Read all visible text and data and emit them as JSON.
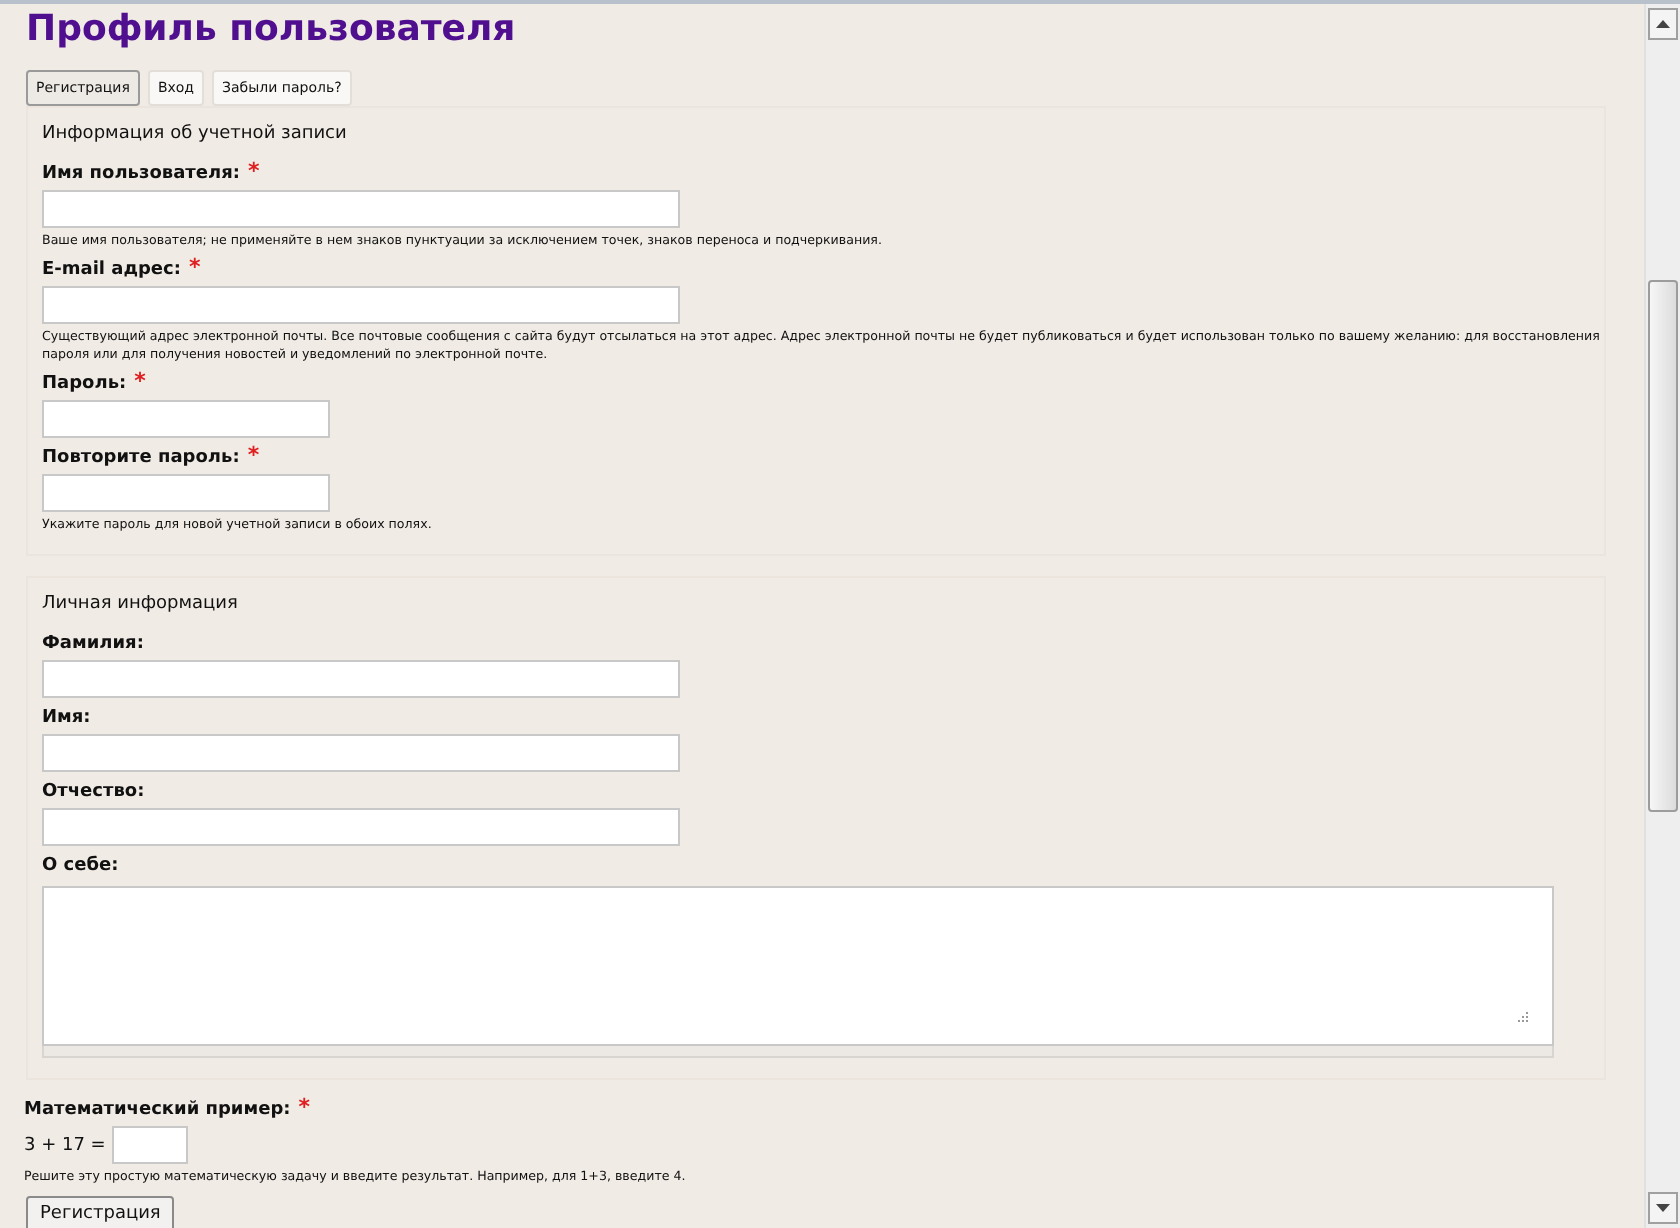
{
  "title": "Профиль пользователя",
  "tabs": [
    {
      "label": "Регистрация",
      "selected": true
    },
    {
      "label": "Вход",
      "selected": false
    },
    {
      "label": "Забыли пароль?",
      "selected": false
    }
  ],
  "required_mark": "*",
  "sections": [
    {
      "legend": "Информация об учетной записи",
      "fields": [
        {
          "kind": "wide_input",
          "label": "Имя пользователя:",
          "required": true,
          "description": "Ваше имя пользователя; не применяйте в нем знаков пунктуации за исключением точек, знаков переноса и подчеркивания."
        },
        {
          "kind": "wide_input",
          "label": "E-mail адрес:",
          "required": true,
          "description": "Существующий адрес электронной почты. Все почтовые сообщения с сайта будут отсылаться на этот адрес. Адрес электронной почты не будет публиковаться и будет использован только по вашему желанию: для восстановления пароля или для получения новостей и уведомлений по электронной почте."
        },
        {
          "kind": "narrow_input",
          "label": "Пароль:",
          "required": true
        },
        {
          "kind": "narrow_input",
          "label": "Повторите пароль:",
          "required": true,
          "description": "Укажите пароль для новой учетной записи в обоих полях."
        }
      ]
    },
    {
      "legend": "Личная информация",
      "fields": [
        {
          "kind": "wide_input",
          "label": "Фамилия:"
        },
        {
          "kind": "wide_input",
          "label": "Имя:"
        },
        {
          "kind": "wide_input",
          "label": "Отчество:"
        },
        {
          "kind": "textarea",
          "label": "О себе:"
        }
      ]
    }
  ],
  "captcha": {
    "label": "Математический пример:",
    "required": true,
    "question": "3 + 17 =",
    "description": "Решите эту простую математическую задачу и введите результат. Например, для 1+3, введите 4."
  },
  "submit_button": "Регистрация"
}
